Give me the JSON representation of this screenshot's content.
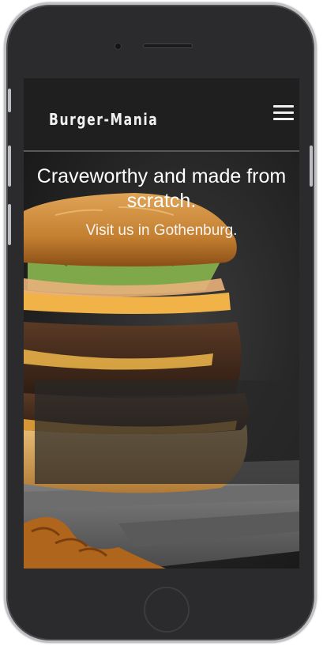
{
  "navbar": {
    "brand": "Burger-Mania",
    "menu_icon": "hamburger-menu-icon"
  },
  "hero": {
    "image": "burger-photo",
    "title": "Craveworthy and made from scratch.",
    "subtitle": "Visit us in Gothenburg."
  },
  "colors": {
    "phone_body": "#2b2b2d",
    "navbar_bg": "#1f1f1f",
    "text": "#ffffff"
  }
}
